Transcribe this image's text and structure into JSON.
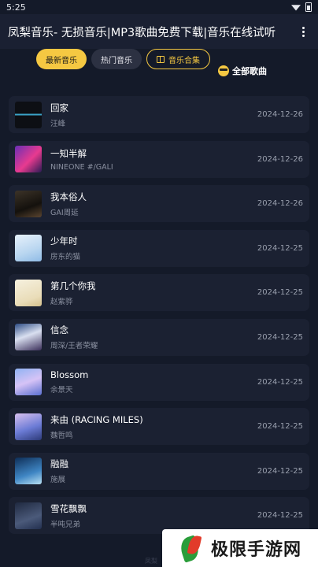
{
  "status": {
    "time": "5:25"
  },
  "header": {
    "title": "凤梨音乐- 无损音乐|MP3歌曲免费下载|音乐在线试听"
  },
  "tabs": [
    {
      "label": "最新音乐"
    },
    {
      "label": "热门音乐"
    },
    {
      "label": "音乐合集"
    }
  ],
  "all_songs_label": "全部歌曲",
  "songs": [
    {
      "title": "回家",
      "artist": "汪峰",
      "date": "2024-12-26"
    },
    {
      "title": "一知半解",
      "artist": "NINEONE #/GALI",
      "date": "2024-12-26"
    },
    {
      "title": "我本俗人",
      "artist": "GAI周延",
      "date": "2024-12-26"
    },
    {
      "title": "少年时",
      "artist": "房东的猫",
      "date": "2024-12-25"
    },
    {
      "title": "第几个你我",
      "artist": "赵紫骅",
      "date": "2024-12-25"
    },
    {
      "title": "信念",
      "artist": "周深/王者荣耀",
      "date": "2024-12-25"
    },
    {
      "title": "Blossom",
      "artist": "余景天",
      "date": "2024-12-25"
    },
    {
      "title": "来由 (RACING MILES)",
      "artist": "魏哲鸣",
      "date": "2024-12-25"
    },
    {
      "title": "融融",
      "artist": "施展",
      "date": "2024-12-25"
    },
    {
      "title": "雪花飘飘",
      "artist": "半吨兄弟",
      "date": "2024-12-25"
    }
  ],
  "watermark": {
    "text": "极限手游网",
    "small": "凤梨"
  },
  "colors": {
    "accent": "#f5c842",
    "background": "#141a29",
    "card": "#1b2132"
  }
}
